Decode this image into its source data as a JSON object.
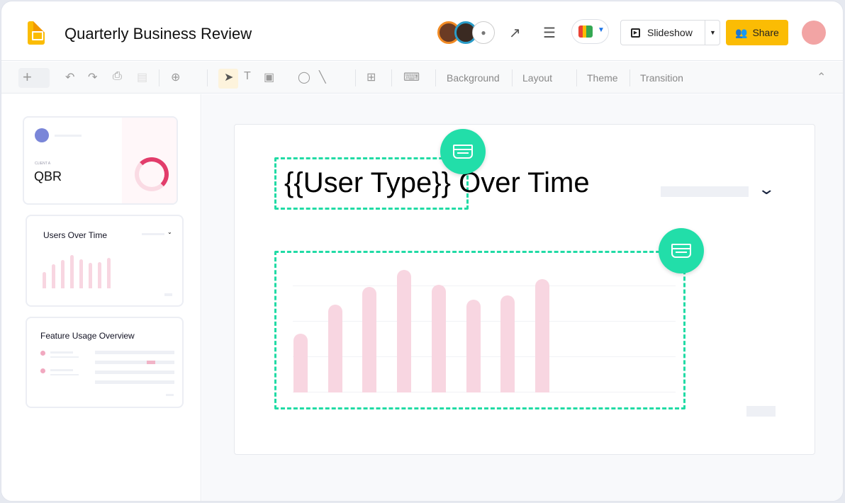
{
  "app": {
    "title": "Quarterly Business Review"
  },
  "header": {
    "slideshow_label": "Slideshow",
    "share_label": "Share"
  },
  "toolbar": {
    "background": "Background",
    "layout": "Layout",
    "theme": "Theme",
    "transition": "Transition"
  },
  "thumbnails": [
    {
      "eyebrow": "CLIENT A",
      "title": "QBR"
    },
    {
      "title": "Users Over Time"
    },
    {
      "title": "Feature Usage Overview"
    }
  ],
  "slide": {
    "title_placeholder": "{{User Type}}",
    "title_rest": " Over Time",
    "chart_bars": [
      83,
      124,
      149,
      173,
      152,
      131,
      137,
      160
    ]
  },
  "colors": {
    "accent": "#22dea9",
    "share": "#fbbc04",
    "bar": "#f8d6e1"
  }
}
